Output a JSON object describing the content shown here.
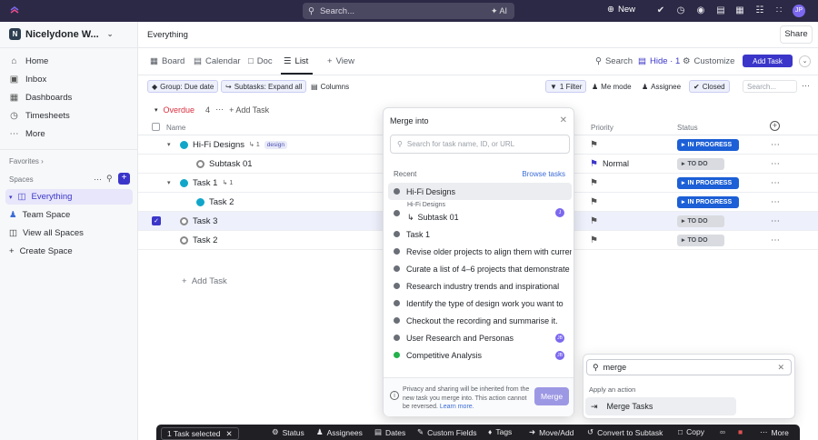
{
  "topbar": {
    "search_placeholder": "Search...",
    "ai_label": "AI",
    "new_label": "New",
    "avatar": "JP"
  },
  "sidebar": {
    "workspace": "Nicelydone W...",
    "workspace_badge": "N",
    "nav": [
      "Home",
      "Inbox",
      "Dashboards",
      "Timesheets",
      "More"
    ],
    "favorites_label": "Favorites",
    "spaces_label": "Spaces",
    "spaces": [
      "Everything",
      "Team Space",
      "View all Spaces",
      "Create Space"
    ]
  },
  "header": {
    "title": "Everything",
    "share": "Share"
  },
  "tabs": [
    "Board",
    "Calendar",
    "Doc",
    "List",
    "View"
  ],
  "toolbar_right": {
    "search": "Search",
    "hide": "Hide · 1",
    "customize": "Customize",
    "add_task": "Add Task"
  },
  "filters": {
    "group": "Group: Due date",
    "subtasks": "Subtasks: Expand all",
    "columns": "Columns",
    "filter": "1 Filter",
    "me_mode": "Me mode",
    "assignee": "Assignee",
    "closed": "Closed",
    "search_placeholder": "Search..."
  },
  "group": {
    "label": "Overdue",
    "count": "4",
    "add_task": "Add Task"
  },
  "columns": {
    "name": "Name",
    "priority": "Priority",
    "status": "Status"
  },
  "rows": [
    {
      "name": "Hi-Fi Designs",
      "subcount": "1",
      "tag": "design",
      "priority": "",
      "status": "IN PROGRESS"
    },
    {
      "name": "Subtask 01",
      "priority": "Normal",
      "status": "TO DO"
    },
    {
      "name": "Task 1",
      "subcount": "1",
      "priority": "",
      "status": "IN PROGRESS"
    },
    {
      "name": "Task 2",
      "priority": "",
      "status": "IN PROGRESS"
    },
    {
      "name": "Task 3",
      "priority": "",
      "status": "TO DO"
    },
    {
      "name": "Task 2",
      "priority": "",
      "status": "TO DO"
    }
  ],
  "add_task_row": "Add Task",
  "merge_modal": {
    "title": "Merge into",
    "search_placeholder": "Search for task name, ID, or URL",
    "recent": "Recent",
    "browse": "Browse tasks",
    "items": [
      "Hi-Fi Designs",
      "Subtask 01",
      "Task 1",
      "Revise older projects to align them with current",
      "Curate a list of 4–6 projects that demonstrate",
      "Research industry trends and inspirational",
      "Identify the type of design work you want to",
      "Checkout the recording and summarise it.",
      "User Research and Personas",
      "Competitive Analysis"
    ],
    "subtask_parent": "Hi-Fi Designs",
    "footer_text": "Privacy and sharing will be inherited from the new task you merge into. This action cannot be reversed.",
    "learn_more": "Learn more.",
    "merge_button": "Merge"
  },
  "command": {
    "query": "merge",
    "apply_label": "Apply an action",
    "action": "Merge Tasks"
  },
  "bulk_bar": {
    "selected": "1 Task selected",
    "actions": [
      "Status",
      "Assignees",
      "Dates",
      "Custom Fields",
      "Tags",
      "Move/Add",
      "Convert to Subtask",
      "Copy",
      "More"
    ]
  },
  "colors": {
    "topbar": "#2c2946",
    "accent": "#3b36c9",
    "in_progress": "#1c5fd6",
    "to_do": "#d9dbe0"
  }
}
